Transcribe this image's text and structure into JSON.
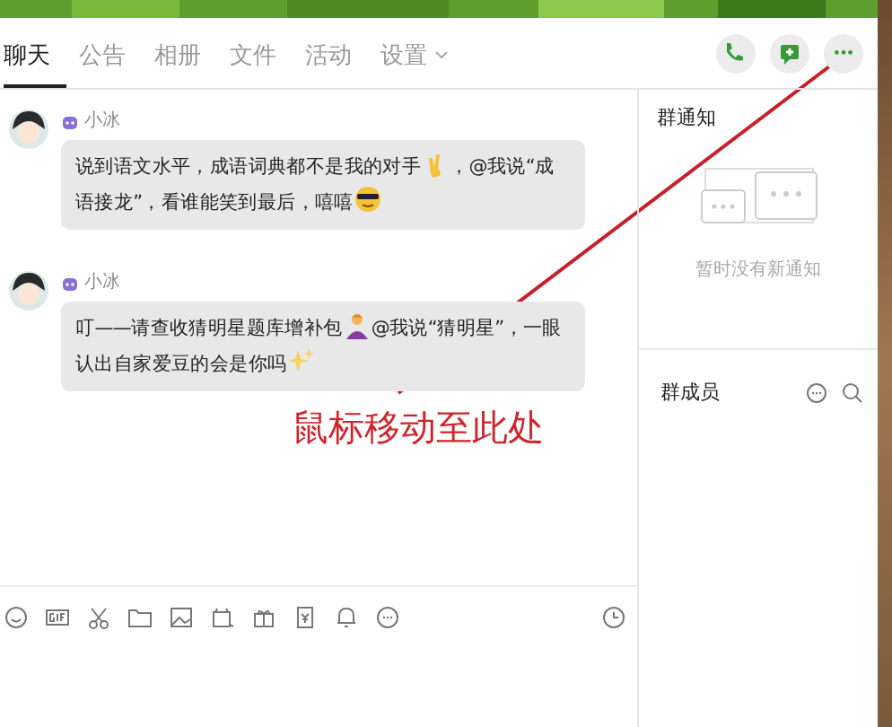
{
  "tabs": [
    {
      "label": "聊天",
      "selected": true
    },
    {
      "label": "公告",
      "selected": false
    },
    {
      "label": "相册",
      "selected": false
    },
    {
      "label": "文件",
      "selected": false
    },
    {
      "label": "活动",
      "selected": false
    },
    {
      "label": "设置",
      "selected": false,
      "dropdown": true
    }
  ],
  "messages": [
    {
      "sender": "小冰",
      "parts": [
        {
          "kind": "text",
          "text": "说到语文水平，成语词典都不是我的对手"
        },
        {
          "kind": "victory"
        },
        {
          "kind": "text",
          "text": "，@我说“成语接龙”，看谁能笑到最后，嘻嘻"
        },
        {
          "kind": "sunglasses"
        }
      ]
    },
    {
      "sender": "小冰",
      "parts": [
        {
          "kind": "text",
          "text": "叮——请查收猜明星题库增补包"
        },
        {
          "kind": "person"
        },
        {
          "kind": "text",
          "text": "@我说“猜明星”，一眼认出自家爱豆的会是你吗"
        },
        {
          "kind": "sparkles"
        }
      ]
    }
  ],
  "notice": {
    "title": "群通知",
    "empty_text": "暂时没有新通知"
  },
  "members": {
    "title": "群成员"
  },
  "annotation": {
    "text": "鼠标移动至此处"
  }
}
